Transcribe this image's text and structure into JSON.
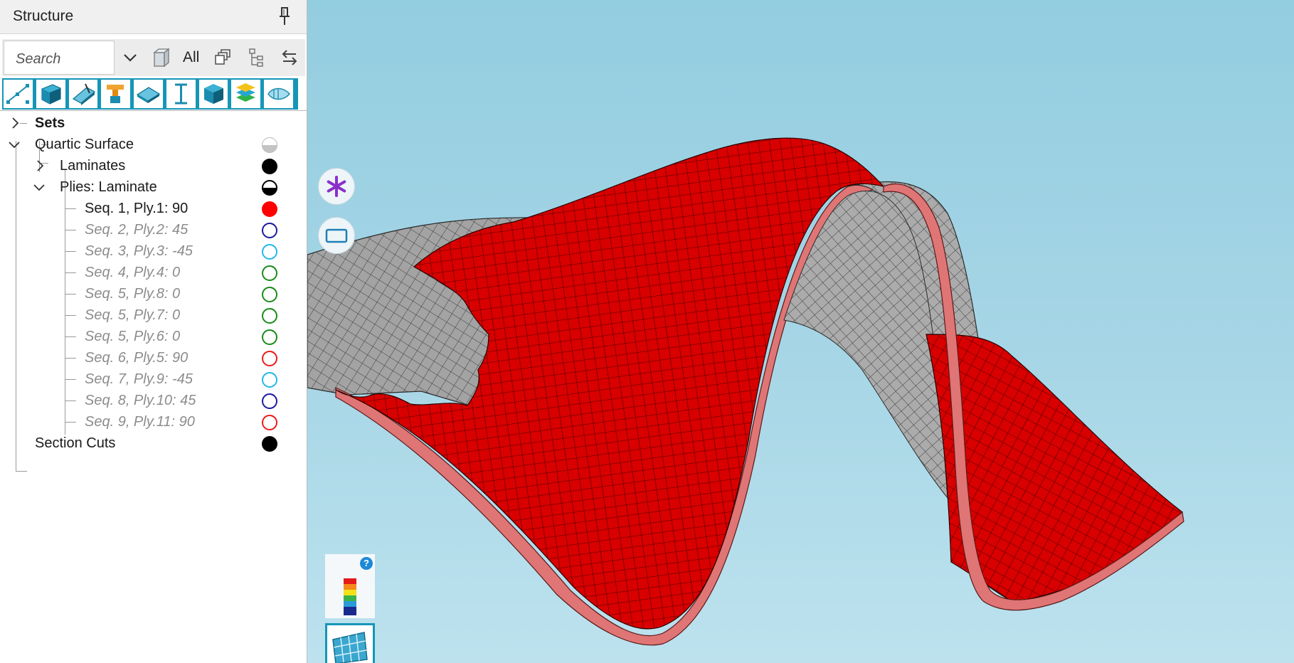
{
  "panel": {
    "title": "Structure",
    "search": {
      "placeholder": "Search",
      "value": ""
    },
    "filter_label": "All",
    "toolbar_icons": [
      "line-mesh-icon",
      "solid-body-icon",
      "shell-edge-icon",
      "beam-section-icon",
      "plane-surface-icon",
      "i-beam-icon",
      "cube-icon",
      "layers-icon",
      "fiber-direction-icon"
    ]
  },
  "tree": {
    "sets": {
      "label": "Sets"
    },
    "quartic_surface": {
      "label": "Quartic Surface",
      "swatch": "#d0d0d0"
    },
    "laminates": {
      "label": "Laminates",
      "swatch": "#000000"
    },
    "plies": {
      "label": "Plies: Laminate",
      "swatch": "half"
    },
    "section_cuts": {
      "label": "Section Cuts",
      "swatch": "#000000"
    },
    "ply_items": [
      {
        "label": "Seq. 1, Ply.1: 90",
        "active": true,
        "color": "#ff0000",
        "filled": true
      },
      {
        "label": "Seq. 2, Ply.2: 45",
        "active": false,
        "color": "#1a1aa0",
        "filled": false
      },
      {
        "label": "Seq. 3, Ply.3: -45",
        "active": false,
        "color": "#22b8e8",
        "filled": false
      },
      {
        "label": "Seq. 4, Ply.4: 0",
        "active": false,
        "color": "#1a8c1a",
        "filled": false
      },
      {
        "label": "Seq. 5, Ply.8: 0",
        "active": false,
        "color": "#1a8c1a",
        "filled": false
      },
      {
        "label": "Seq. 5, Ply.7: 0",
        "active": false,
        "color": "#1a8c1a",
        "filled": false
      },
      {
        "label": "Seq. 5, Ply.6: 0",
        "active": false,
        "color": "#1a8c1a",
        "filled": false
      },
      {
        "label": "Seq. 6, Ply.5: 90",
        "active": false,
        "color": "#ee1c1c",
        "filled": false
      },
      {
        "label": "Seq. 7, Ply.9: -45",
        "active": false,
        "color": "#22b8e8",
        "filled": false
      },
      {
        "label": "Seq. 8, Ply.10: 45",
        "active": false,
        "color": "#1a1aa0",
        "filled": false
      },
      {
        "label": "Seq. 9, Ply.11: 90",
        "active": false,
        "color": "#ee1c1c",
        "filled": false
      }
    ]
  },
  "viewport": {
    "help_label": "?",
    "ply_color": "#d80000",
    "laminate_edge_color": "#dd7070",
    "base_surface_color": "#9a9a9a"
  }
}
